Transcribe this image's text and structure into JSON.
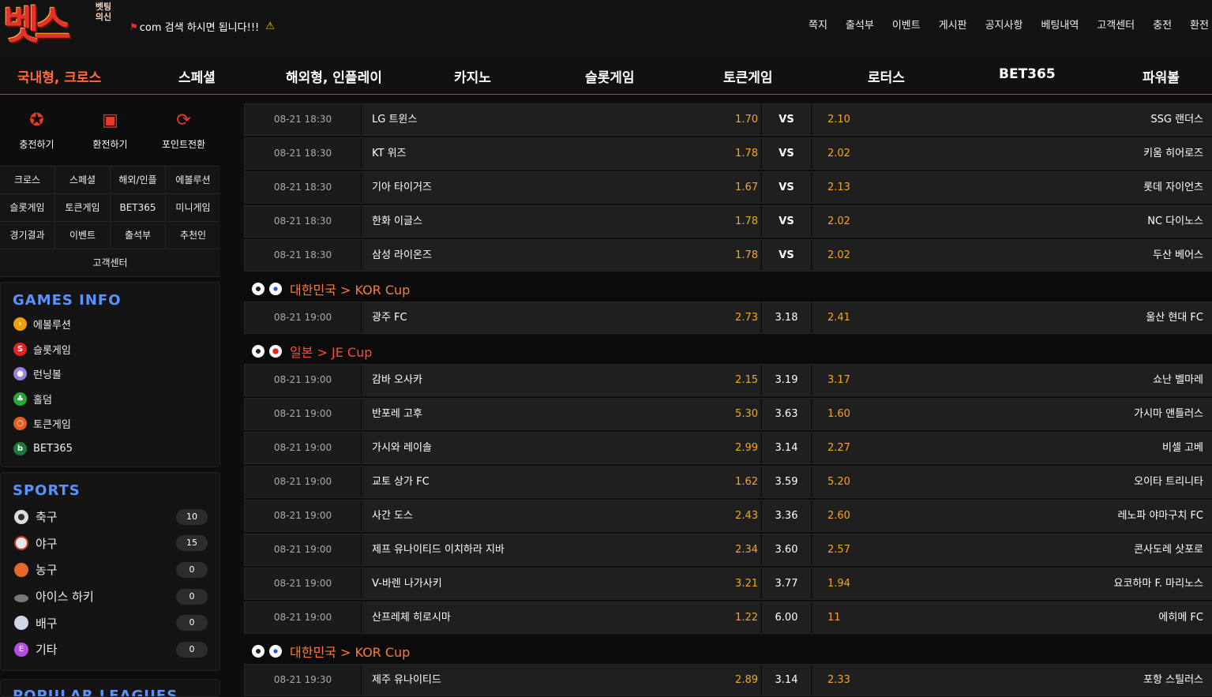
{
  "brand": {
    "logo_main": "벳스",
    "logo_sub": "벳팅의신"
  },
  "header": {
    "notice": "com 검색 하시면 됩니다!!!",
    "topnav": [
      "쪽지",
      "출석부",
      "이벤트",
      "게시판",
      "공지사항",
      "베팅내역",
      "고객센터",
      "충전",
      "환전"
    ]
  },
  "mainnav": [
    "국내형, 크로스",
    "스페셜",
    "해외형, 인플레이",
    "카지노",
    "슬롯게임",
    "토큰게임",
    "로터스",
    "BET365",
    "파워볼"
  ],
  "quick": [
    {
      "label": "충전하기",
      "icon": "deposit-icon"
    },
    {
      "label": "환전하기",
      "icon": "withdraw-icon"
    },
    {
      "label": "포인트전환",
      "icon": "point-convert-icon"
    }
  ],
  "menugrid": [
    [
      "크로스",
      "스페셜",
      "해외/인플",
      "에볼루션"
    ],
    [
      "슬롯게임",
      "토큰게임",
      "BET365",
      "미니게임"
    ],
    [
      "경기결과",
      "이벤트",
      "출석부",
      "추천인"
    ],
    [
      "고객센터"
    ]
  ],
  "games_info": {
    "title": "GAMES INFO",
    "items": [
      {
        "label": "에볼루션",
        "color": "#f0a000",
        "glyph": "›"
      },
      {
        "label": "슬롯게임",
        "color": "#e62222",
        "glyph": "S"
      },
      {
        "label": "런닝볼",
        "color": "#9b7ee0",
        "glyph": "●"
      },
      {
        "label": "홀덤",
        "color": "#27a83a",
        "glyph": "♣"
      },
      {
        "label": "토큰게임",
        "color": "#e85d1c",
        "glyph": "○"
      },
      {
        "label": "BET365",
        "color": "#1d7a3d",
        "glyph": "b"
      }
    ]
  },
  "sports": {
    "title": "SPORTS",
    "items": [
      {
        "label": "축구",
        "count": "10",
        "color": "#dddddd"
      },
      {
        "label": "야구",
        "count": "15",
        "color": "#e8e8e8"
      },
      {
        "label": "농구",
        "count": "0",
        "color": "#e8672a"
      },
      {
        "label": "아이스 하키",
        "count": "0",
        "color": "#777777"
      },
      {
        "label": "배구",
        "count": "0",
        "color": "#cfd6e6"
      },
      {
        "label": "기타",
        "count": "0",
        "color": "#b64ee6"
      }
    ]
  },
  "popular_title": "POPULAR LEAGUES",
  "games": [
    {
      "time": "08-21 18:30",
      "home": "LG 트윈스",
      "home_odd": "1.70",
      "mid": "VS",
      "away_odd": "2.10",
      "away": "SSG 랜더스"
    },
    {
      "time": "08-21 18:30",
      "home": "KT 위즈",
      "home_odd": "1.78",
      "mid": "VS",
      "away_odd": "2.02",
      "away": "키움 히어로즈"
    },
    {
      "time": "08-21 18:30",
      "home": "기아 타이거즈",
      "home_odd": "1.67",
      "mid": "VS",
      "away_odd": "2.13",
      "away": "롯데 자이언츠"
    },
    {
      "time": "08-21 18:30",
      "home": "한화 이글스",
      "home_odd": "1.78",
      "mid": "VS",
      "away_odd": "2.02",
      "away": "NC 다이노스"
    },
    {
      "time": "08-21 18:30",
      "home": "삼성 라이온즈",
      "home_odd": "1.78",
      "mid": "VS",
      "away_odd": "2.02",
      "away": "두산 베어스"
    }
  ],
  "league1": "대한민국 > KOR Cup",
  "games2": [
    {
      "time": "08-21 19:00",
      "home": "광주 FC",
      "home_odd": "2.73",
      "mid": "3.18",
      "away_odd": "2.41",
      "away": "울산 현대 FC"
    }
  ],
  "league2": "일본 > JE Cup",
  "games3": [
    {
      "time": "08-21 19:00",
      "home": "감바 오사카",
      "home_odd": "2.15",
      "mid": "3.19",
      "away_odd": "3.17",
      "away": "쇼난 벨마레"
    },
    {
      "time": "08-21 19:00",
      "home": "반포레 고후",
      "home_odd": "5.30",
      "mid": "3.63",
      "away_odd": "1.60",
      "away": "가시마 앤틀러스"
    },
    {
      "time": "08-21 19:00",
      "home": "가시와 레이솔",
      "home_odd": "2.99",
      "mid": "3.14",
      "away_odd": "2.27",
      "away": "비셀 고베"
    },
    {
      "time": "08-21 19:00",
      "home": "교토 상가 FC",
      "home_odd": "1.62",
      "mid": "3.59",
      "away_odd": "5.20",
      "away": "오이타 트리니타"
    },
    {
      "time": "08-21 19:00",
      "home": "사간 도스",
      "home_odd": "2.43",
      "mid": "3.36",
      "away_odd": "2.60",
      "away": "레노파 야마구치 FC"
    },
    {
      "time": "08-21 19:00",
      "home": "제프 유나이티드 이치하라 지바",
      "home_odd": "2.34",
      "mid": "3.60",
      "away_odd": "2.57",
      "away": "콘사도레 삿포로"
    },
    {
      "time": "08-21 19:00",
      "home": "V-바렌 나가사키",
      "home_odd": "3.21",
      "mid": "3.77",
      "away_odd": "1.94",
      "away": "요코하마 F. 마리노스"
    },
    {
      "time": "08-21 19:00",
      "home": "산프레체 히로시마",
      "home_odd": "1.22",
      "mid": "6.00",
      "away_odd": "11",
      "away": "에히메 FC"
    }
  ],
  "league3": "대한민국 > KOR Cup",
  "games4": [
    {
      "time": "08-21 19:30",
      "home": "제주 유나이티드",
      "home_odd": "2.89",
      "mid": "3.14",
      "away_odd": "2.33",
      "away": "포항 스틸러스"
    }
  ]
}
